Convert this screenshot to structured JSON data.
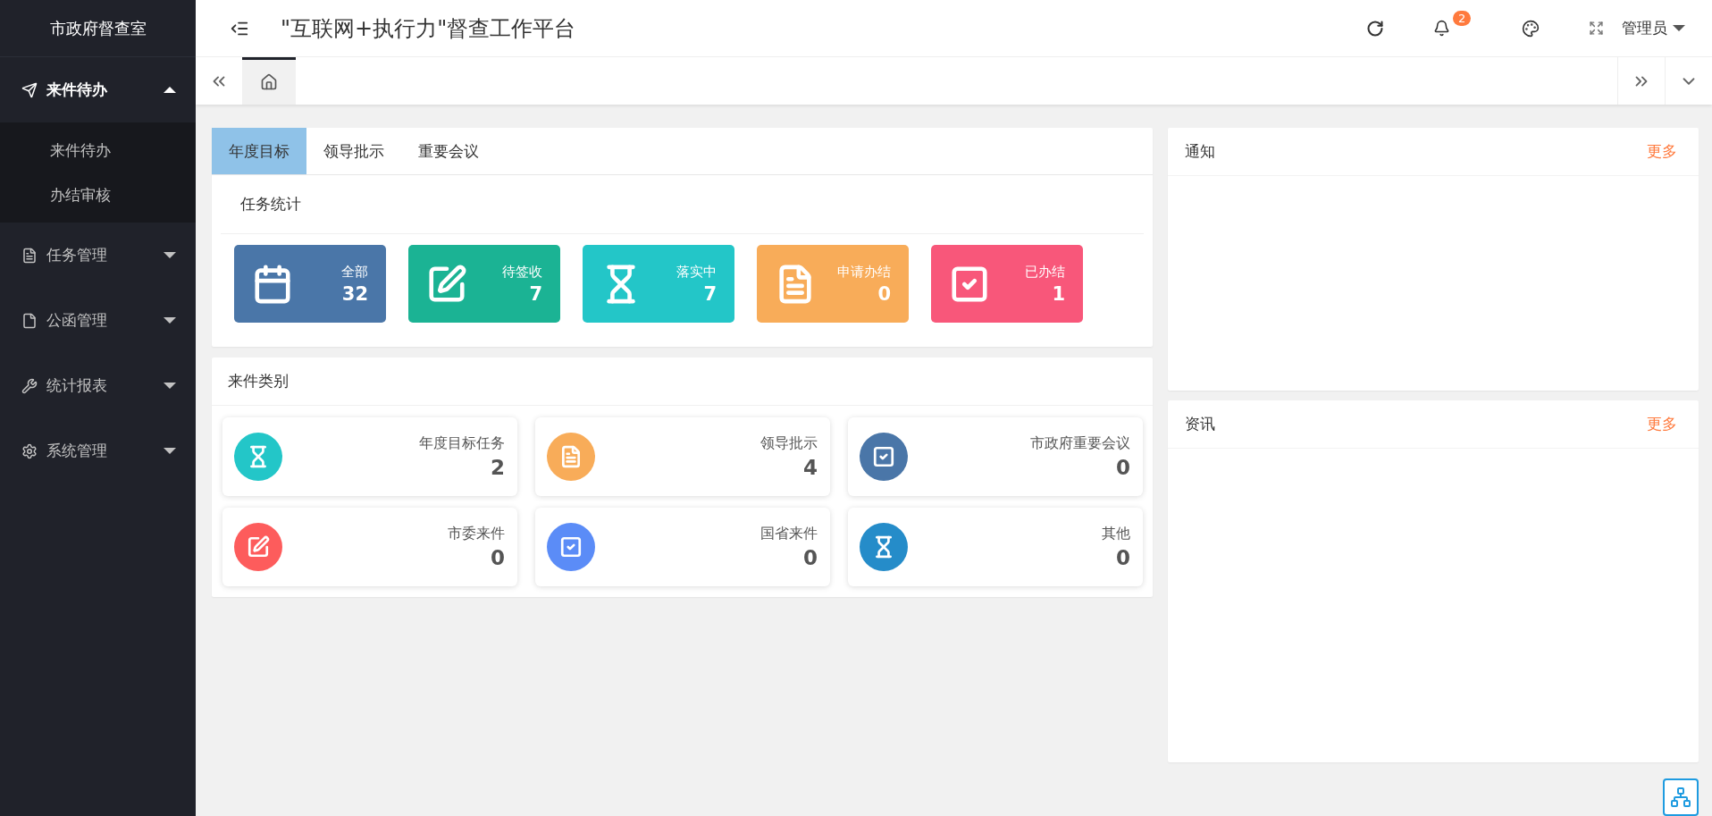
{
  "sidebar": {
    "title": "市政府督查室",
    "items": [
      {
        "label": "来件待办",
        "expanded": true,
        "children": [
          {
            "label": "来件待办"
          },
          {
            "label": "办结审核"
          }
        ]
      },
      {
        "label": "任务管理",
        "expanded": false
      },
      {
        "label": "公函管理",
        "expanded": false
      },
      {
        "label": "统计报表",
        "expanded": false
      },
      {
        "label": "系统管理",
        "expanded": false
      }
    ]
  },
  "header": {
    "title": "\"互联网+执行力\"督查工作平台",
    "notification_count": "2",
    "user": "管理员"
  },
  "page_tabs": [
    {
      "selected": true
    }
  ],
  "main_tabs": [
    {
      "label": "年度目标",
      "selected": true
    },
    {
      "label": "领导批示",
      "selected": false
    },
    {
      "label": "重要会议",
      "selected": false
    }
  ],
  "task_stats": {
    "title": "任务统计",
    "cards": [
      {
        "label": "全部",
        "value": "32",
        "color": "#4a76a8"
      },
      {
        "label": "待签收",
        "value": "7",
        "color": "#1bb394"
      },
      {
        "label": "落实中",
        "value": "7",
        "color": "#23c6c8"
      },
      {
        "label": "申请办结",
        "value": "0",
        "color": "#f8ac59"
      },
      {
        "label": "已办结",
        "value": "1",
        "color": "#f8577a"
      }
    ]
  },
  "categories": {
    "title": "来件类别",
    "cards": [
      {
        "label": "年度目标任务",
        "value": "2",
        "color": "#23c6c8"
      },
      {
        "label": "领导批示",
        "value": "4",
        "color": "#f8ac59"
      },
      {
        "label": "市政府重要会议",
        "value": "0",
        "color": "#4a76a8"
      },
      {
        "label": "市委来件",
        "value": "0",
        "color": "#fd5c5c"
      },
      {
        "label": "国省来件",
        "value": "0",
        "color": "#5b8cf7"
      },
      {
        "label": "其他",
        "value": "0",
        "color": "#258cc9"
      }
    ]
  },
  "panels": [
    {
      "title": "通知",
      "more": "更多"
    },
    {
      "title": "资讯",
      "more": "更多"
    }
  ]
}
